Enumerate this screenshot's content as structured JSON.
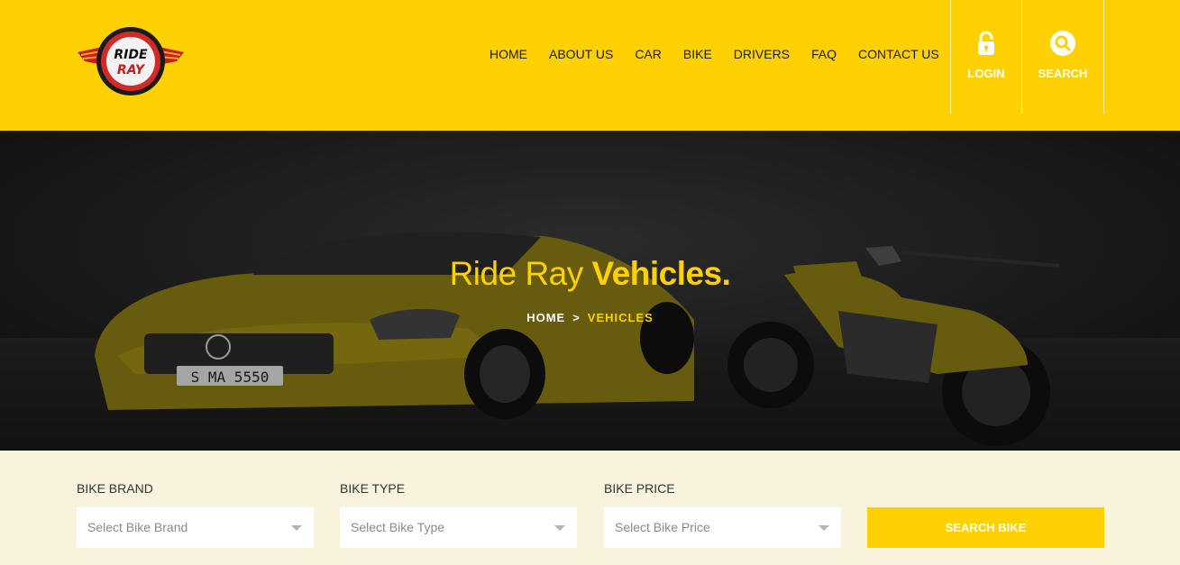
{
  "brand": {
    "logo_line1": "RIDE",
    "logo_line2": "RAY"
  },
  "nav": [
    "HOME",
    "ABOUT US",
    "CAR",
    "BIKE",
    "DRIVERS",
    "FAQ",
    "CONTACT US"
  ],
  "header_buttons": {
    "login": {
      "label": "LOGIN",
      "icon": "lock-icon"
    },
    "search": {
      "label": "SEARCH",
      "icon": "search-icon"
    }
  },
  "hero": {
    "title_regular": "Ride Ray",
    "title_bold": "Vehicles.",
    "breadcrumb_home": "HOME",
    "breadcrumb_separator": ">",
    "breadcrumb_current": "VEHICLES",
    "car_plate": "S MA 5550"
  },
  "filters": {
    "brand": {
      "label": "BIKE BRAND",
      "placeholder": "Select Bike Brand"
    },
    "type": {
      "label": "BIKE TYPE",
      "placeholder": "Select Bike Type"
    },
    "price": {
      "label": "BIKE PRICE",
      "placeholder": "Select Bike Price"
    },
    "submit_label": "SEARCH BIKE"
  },
  "colors": {
    "accent": "#ffd100",
    "filter_bg": "#f8f3dc",
    "hero_overlay": "#1e1e1e"
  }
}
